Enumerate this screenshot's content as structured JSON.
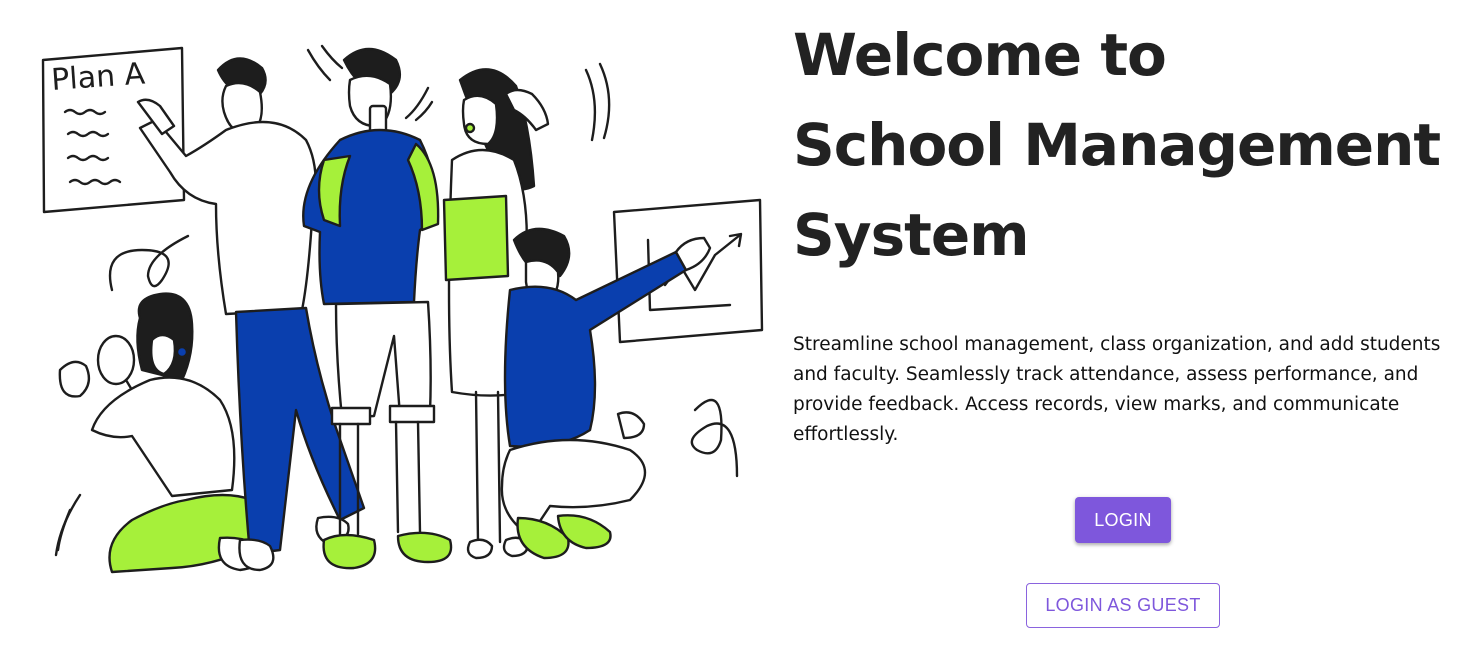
{
  "hero": {
    "title_lines": [
      "Welcome to",
      "School Management",
      "System"
    ],
    "description": "Streamline school management, class organization, and add students and faculty. Seamlessly track attendance, assess performance, and provide feedback. Access records, view marks, and communicate effortlessly."
  },
  "illustration": {
    "board_text": "Plan A"
  },
  "buttons": {
    "login_label": "LOGIN",
    "guest_label": "LOGIN AS GUEST"
  },
  "colors": {
    "accent": "#7e57dc",
    "illustration_blue": "#0a3fae",
    "illustration_green": "#a6f03a",
    "text_dark": "#222222"
  }
}
